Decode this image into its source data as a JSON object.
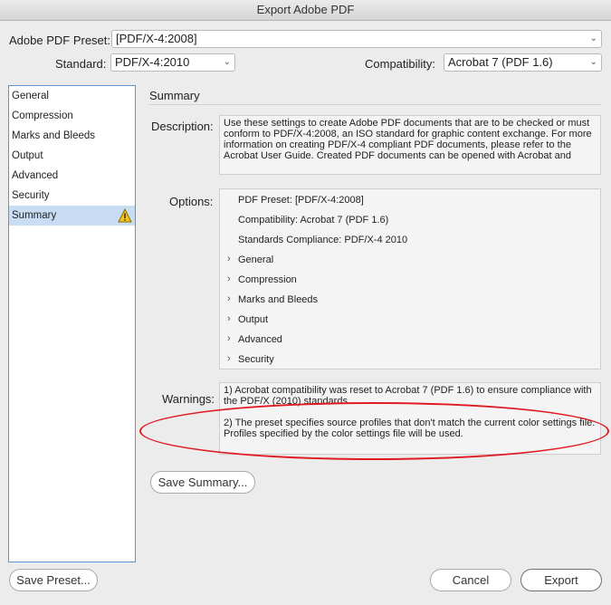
{
  "window": {
    "title": "Export Adobe PDF"
  },
  "preset": {
    "label": "Adobe PDF Preset:",
    "value": "[PDF/X-4:2008]"
  },
  "standard": {
    "label": "Standard:",
    "value": "PDF/X-4:2010"
  },
  "compatibility": {
    "label": "Compatibility:",
    "value": "Acrobat 7 (PDF 1.6)"
  },
  "sidebar": {
    "items": [
      {
        "label": "General"
      },
      {
        "label": "Compression"
      },
      {
        "label": "Marks and Bleeds"
      },
      {
        "label": "Output"
      },
      {
        "label": "Advanced"
      },
      {
        "label": "Security"
      },
      {
        "label": "Summary",
        "icon": "warning-icon"
      }
    ]
  },
  "summary": {
    "title": "Summary",
    "description_label": "Description:",
    "description_text": "Use these settings to create Adobe PDF documents that are to be checked or must conform to PDF/X-4:2008, an ISO standard for graphic content exchange.  For more information on creating PDF/X-4 compliant PDF documents, please refer to the Acrobat User Guide.  Created PDF documents can be opened with Acrobat and",
    "options_label": "Options:",
    "options": {
      "lines": [
        "PDF Preset: [PDF/X-4:2008]",
        "Compatibility: Acrobat 7 (PDF 1.6)",
        "Standards Compliance: PDF/X-4 2010"
      ],
      "groups": [
        "General",
        "Compression",
        "Marks and Bleeds",
        "Output",
        "Advanced",
        "Security"
      ]
    },
    "warnings_label": "Warnings:",
    "warnings": [
      "1) Acrobat compatibility was reset to Acrobat 7 (PDF 1.6) to ensure compliance with the PDF/X (2010) standards.",
      "2) The preset specifies source profiles that don't match the current color settings file. Profiles specified by the color settings file will be used."
    ],
    "save_summary_label": "Save Summary..."
  },
  "footer": {
    "save_preset_label": "Save Preset...",
    "cancel_label": "Cancel",
    "export_label": "Export"
  },
  "colors": {
    "highlight_oval": "#e01a22",
    "selection": "#c8dcf3",
    "sidebar_border": "#5b93d3"
  }
}
